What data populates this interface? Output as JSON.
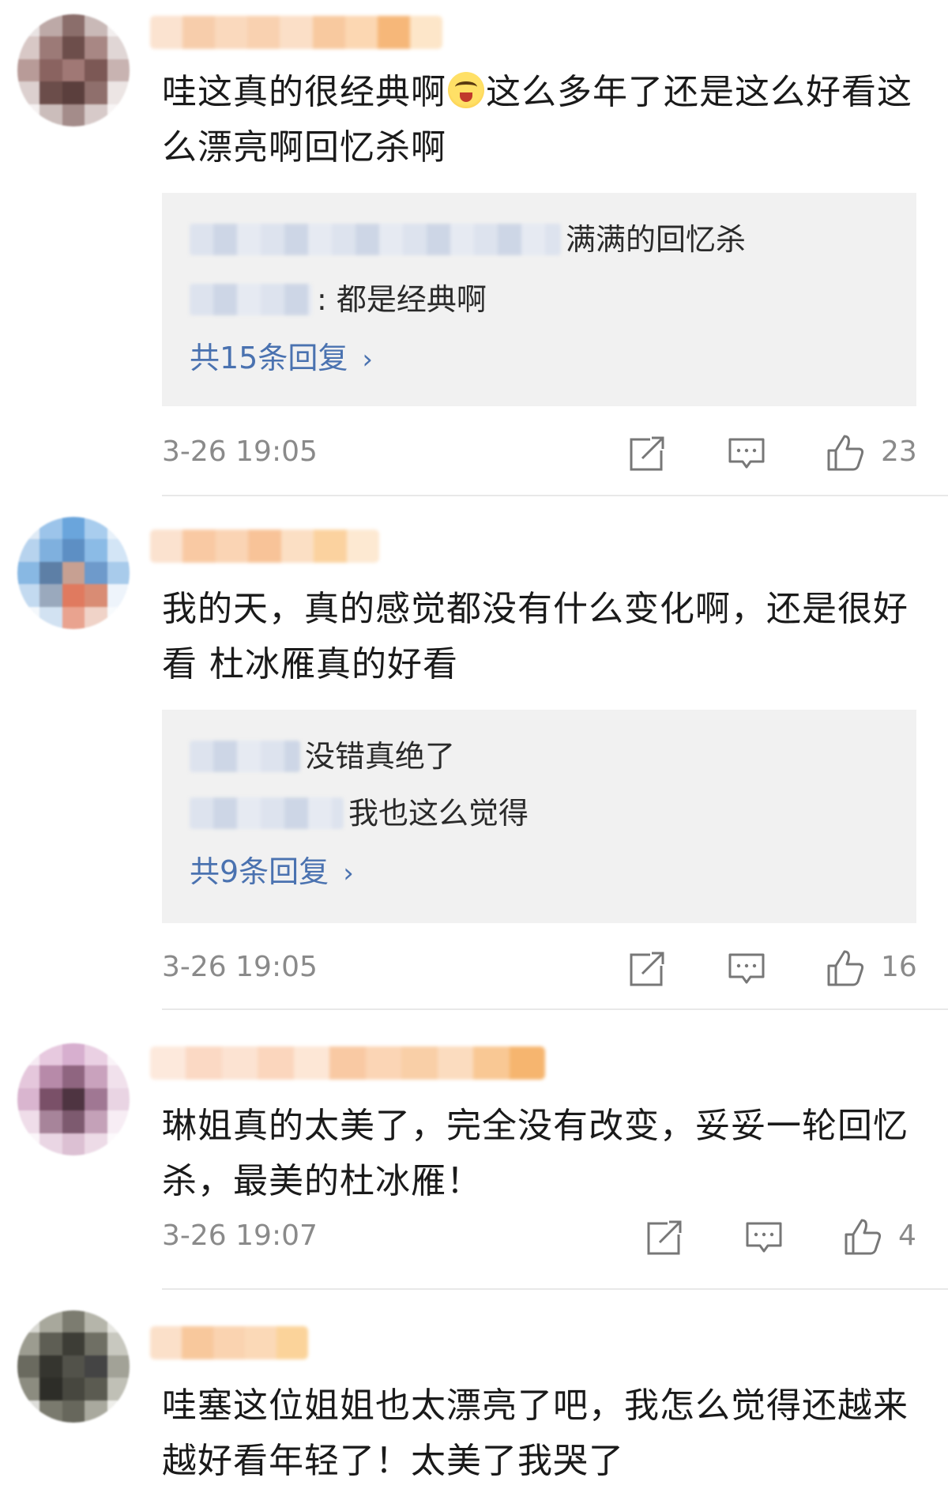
{
  "comments": [
    {
      "text_before_emoji": "哇这真的很经典啊",
      "emoji": "crying-laughing-emoji",
      "text_after_emoji": "这么多年了还是这么好看这么漂亮啊回忆杀啊",
      "replies": [
        {
          "text": "满满的回忆杀"
        },
        {
          "text": ": 都是经典啊"
        }
      ],
      "more_replies": "共15条回复",
      "time": "3-26 19:05",
      "likes": "23"
    },
    {
      "text": "我的天，真的感觉都没有什么变化啊，还是很好看 杜冰雁真的好看",
      "replies": [
        {
          "text": "没错真绝了"
        },
        {
          "text": "我也这么觉得"
        }
      ],
      "more_replies": "共9条回复",
      "time": "3-26 19:05",
      "likes": "16"
    },
    {
      "text": "琳姐真的太美了，完全没有改变，妥妥一轮回忆杀，最美的杜冰雁！",
      "time": "3-26 19:07",
      "likes": "4"
    },
    {
      "text": "哇塞这位姐姐也太漂亮了吧，我怎么觉得还越来越好看年轻了！太美了我哭了"
    }
  ],
  "icons": {
    "share": "share-icon",
    "comment": "comment-icon",
    "like": "thumbs-up-icon"
  },
  "colors": {
    "link": "#4a72b0",
    "meta": "#8a8a8a",
    "reply_bg": "#f1f1f1"
  }
}
